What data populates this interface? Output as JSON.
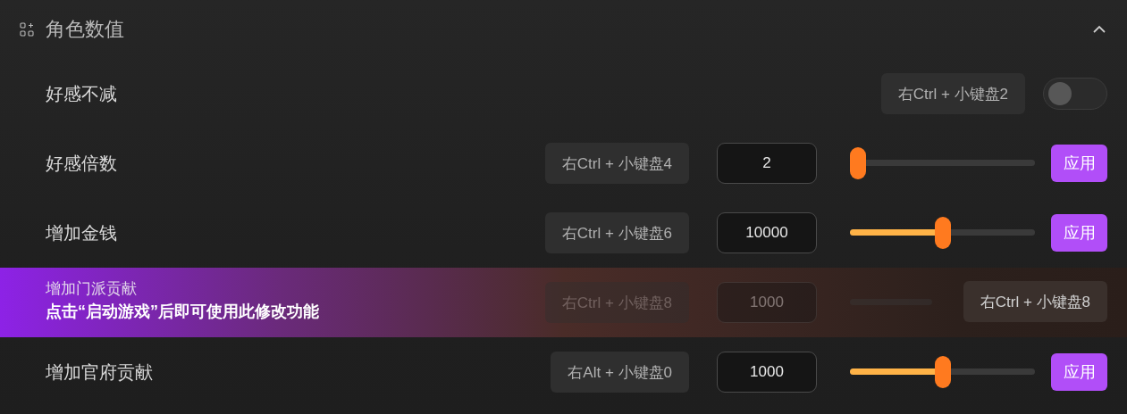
{
  "section": {
    "title": "角色数值",
    "expanded": true
  },
  "rows": [
    {
      "kind": "toggle",
      "label": "好感不减",
      "shortcut": "右Ctrl + 小键盘2",
      "on": false
    },
    {
      "kind": "slider",
      "label": "好感倍数",
      "shortcut": "右Ctrl + 小键盘4",
      "value": "2",
      "level": 0,
      "button": "应用"
    },
    {
      "kind": "slider",
      "label": "增加金钱",
      "shortcut": "右Ctrl + 小键盘6",
      "value": "10000",
      "level": 0.5,
      "button": "应用"
    },
    {
      "kind": "slider",
      "label": "增加门派贡献",
      "shortcut": "右Ctrl + 小键盘8",
      "value": "1000",
      "locked": true,
      "lock_message": "点击“启动游戏”后即可使用此修改功能",
      "lock_shortcut": "右Ctrl + 小键盘8"
    },
    {
      "kind": "slider",
      "label": "增加官府贡献",
      "shortcut": "右Alt + 小键盘0",
      "value": "1000",
      "level": 0.5,
      "button": "应用"
    }
  ]
}
